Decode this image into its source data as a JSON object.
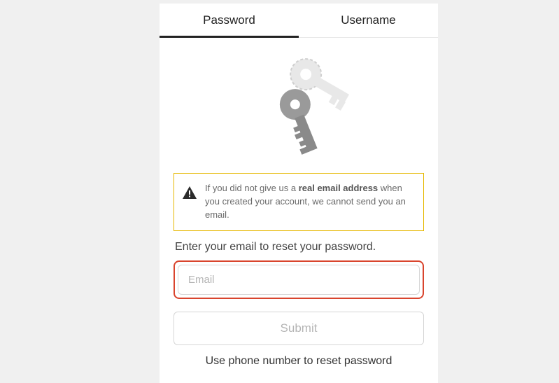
{
  "tabs": {
    "password": "Password",
    "username": "Username"
  },
  "warning": {
    "prefix": "If you did not give us a ",
    "bold": "real email address",
    "suffix": " when you created your account, we cannot send you an email."
  },
  "prompt": "Enter your email to reset your password.",
  "email_placeholder": "Email",
  "submit_label": "Submit",
  "phone_link": "Use phone number to reset password",
  "colors": {
    "accent_yellow": "#f4c430",
    "highlight_red": "#d9442d"
  }
}
